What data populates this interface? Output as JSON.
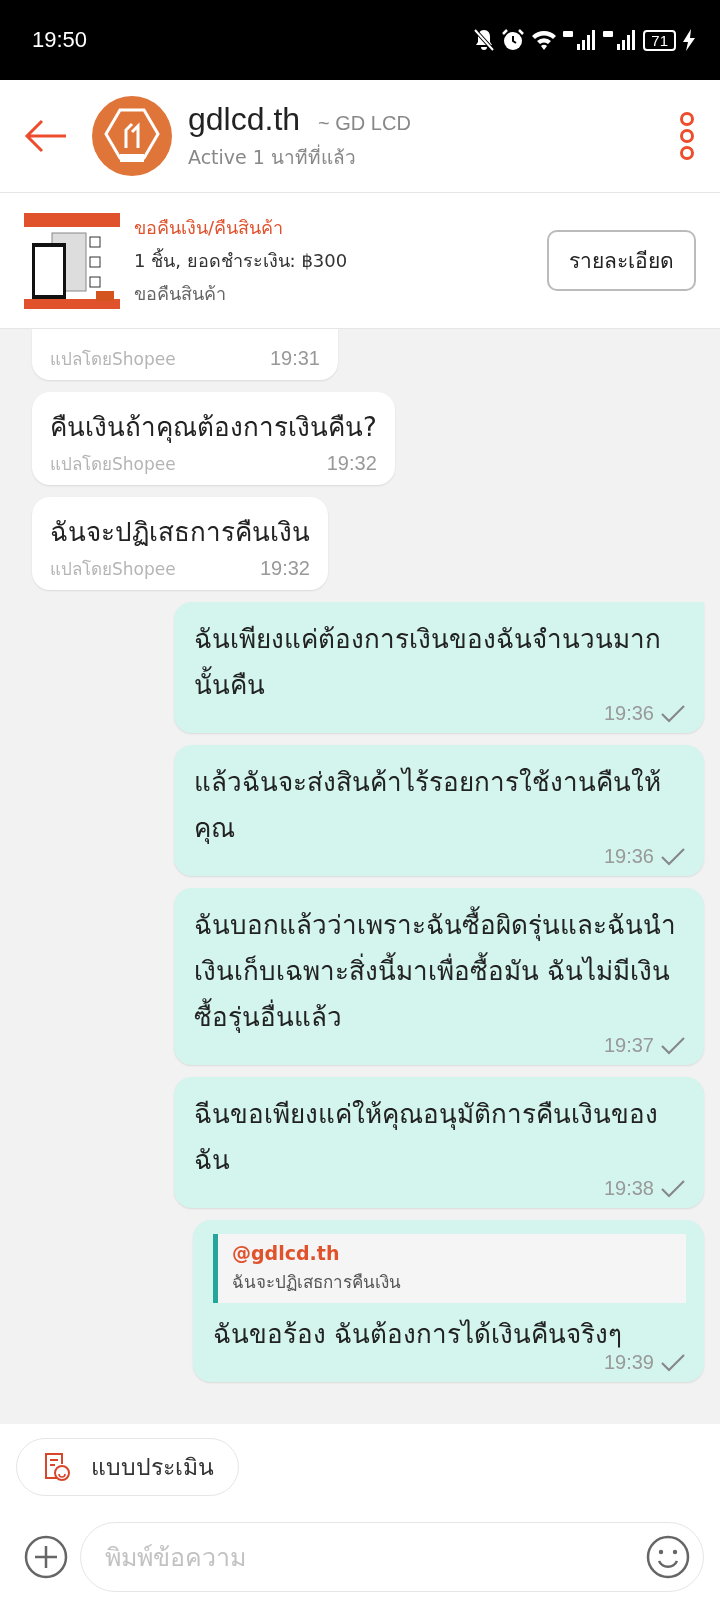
{
  "status_bar": {
    "time": "19:50",
    "battery": "71"
  },
  "header": {
    "name": "gdlcd.th",
    "alias": "~ GD LCD",
    "activity": "Active 1 นาทีที่แล้ว"
  },
  "order": {
    "kind": "picture",
    "title": "ขอคืนเงิน/คืนสินค้า",
    "detail": "1 ชิ้น, ยอดชำระเงิน: ฿300",
    "status": "ขอคืนสินค้า",
    "button": "รายละเอียด"
  },
  "messages": [
    {
      "kind": "incoming",
      "note": "แปลโดยShopee",
      "time": "19:31"
    },
    {
      "kind": "incoming",
      "text": "คืนเงินถ้าคุณต้องการเงินคืน?",
      "note": "แปลโดยShopee",
      "time": "19:32"
    },
    {
      "kind": "incoming",
      "text": "ฉันจะปฏิเสธการคืนเงิน",
      "note": "แปลโดยShopee",
      "time": "19:32"
    },
    {
      "kind": "outgoing",
      "text": "ฉันเพียงแค่ต้องการเงินของฉันจำนวนมากนั้นคืน",
      "time": "19:36",
      "sent": true
    },
    {
      "kind": "outgoing",
      "text": "แล้วฉันจะส่งสินค้าไร้รอยการใช้งานคืนให้คุณ",
      "time": "19:36",
      "sent": true
    },
    {
      "kind": "outgoing",
      "text": "ฉันบอกแล้วว่าเพราะฉันซื้อผิดรุ่นและฉันนำเงินเก็บเฉพาะสิ่งนี้มาเพื่อซื้อมัน ฉันไม่มีเงินซื้อรุ่นอื่นแล้ว",
      "time": "19:37",
      "sent": true
    },
    {
      "kind": "outgoing",
      "text": "ฉีนขอเพียงแค่ให้คุณอนุมัติการคืนเงินของฉัน",
      "time": "19:38",
      "sent": true
    },
    {
      "kind": "outgoing",
      "quote": {
        "author": "@gdlcd.th",
        "text": "ฉันจะปฏิเสธการคืนเงิน"
      },
      "text": "ฉันขอร้อง ฉันต้องการได้เงินคืนจริงๆ",
      "time": "19:39",
      "sent": true
    }
  ],
  "quick_reply": "แบบประเมิน",
  "composer": {
    "placeholder": "พิมพ์ข้อความ"
  }
}
